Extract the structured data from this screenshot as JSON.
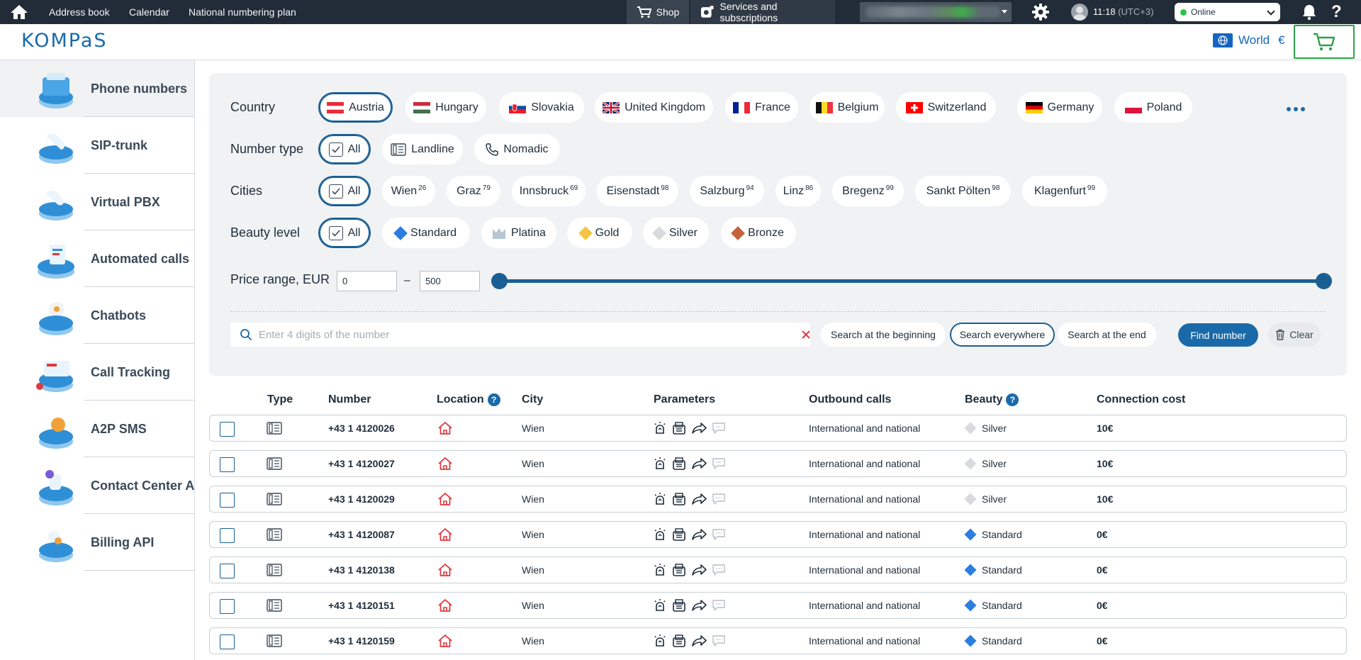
{
  "topbar": {
    "links": [
      "Address book",
      "Calendar",
      "National numbering plan"
    ],
    "shop": "Shop",
    "services": "Services and subscriptions",
    "time": "11:18",
    "timezone": "(UTC+3)",
    "status": "Online",
    "help": "?"
  },
  "header": {
    "logo": "KOMPaS",
    "region": "World",
    "currency": "€"
  },
  "sidebar": {
    "items": [
      {
        "label": "Phone numbers",
        "active": true
      },
      {
        "label": "SIP-trunk",
        "active": false
      },
      {
        "label": "Virtual PBX",
        "active": false
      },
      {
        "label": "Automated calls",
        "active": false
      },
      {
        "label": "Chatbots",
        "active": false
      },
      {
        "label": "Call Tracking",
        "active": false
      },
      {
        "label": "A2P SMS",
        "active": false
      },
      {
        "label": "Contact Center Ai",
        "active": false
      },
      {
        "label": "Billing API",
        "active": false
      }
    ]
  },
  "filters": {
    "country": {
      "label": "Country",
      "options": [
        "Austria",
        "Hungary",
        "Slovakia",
        "United Kingdom",
        "France",
        "Belgium",
        "Switzerland",
        "Germany",
        "Poland"
      ],
      "selected": "Austria"
    },
    "number_type": {
      "label": "Number type",
      "options": [
        "All",
        "Landline",
        "Nomadic"
      ],
      "selected": "All"
    },
    "cities": {
      "label": "Cities",
      "all": "All",
      "options": [
        {
          "name": "Wien",
          "count": "26"
        },
        {
          "name": "Graz",
          "count": "79"
        },
        {
          "name": "Innsbruck",
          "count": "69"
        },
        {
          "name": "Eisenstadt",
          "count": "98"
        },
        {
          "name": "Salzburg",
          "count": "94"
        },
        {
          "name": "Linz",
          "count": "86"
        },
        {
          "name": "Bregenz",
          "count": "99"
        },
        {
          "name": "Sankt Pölten",
          "count": "98"
        },
        {
          "name": "Klagenfurt",
          "count": "99"
        }
      ]
    },
    "beauty": {
      "label": "Beauty level",
      "all": "All",
      "options": [
        {
          "name": "Standard",
          "color": "#2a7de1"
        },
        {
          "name": "Platina",
          "color": "#b8c6d2"
        },
        {
          "name": "Gold",
          "color": "#f4c542"
        },
        {
          "name": "Silver",
          "color": "#d8dadd"
        },
        {
          "name": "Bronze",
          "color": "#c4623a"
        }
      ]
    },
    "price": {
      "label": "Price range, EUR",
      "min": "0",
      "max": "500",
      "dash": "–"
    },
    "search": {
      "placeholder": "Enter 4 digits of the number",
      "modes": [
        "Search at the beginning",
        "Search everywhere",
        "Search at the end"
      ],
      "selected_mode": "Search everywhere",
      "find": "Find number",
      "clear": "Clear"
    }
  },
  "table": {
    "headers": {
      "type": "Type",
      "number": "Number",
      "location": "Location",
      "city": "City",
      "parameters": "Parameters",
      "outbound": "Outbound calls",
      "beauty": "Beauty",
      "cost": "Connection cost"
    },
    "rows": [
      {
        "number": "+43 1 4120026",
        "city": "Wien",
        "outbound": "International and national",
        "beauty": "Silver",
        "beauty_color": "#d8dadd",
        "cost": "10€"
      },
      {
        "number": "+43 1 4120027",
        "city": "Wien",
        "outbound": "International and national",
        "beauty": "Silver",
        "beauty_color": "#d8dadd",
        "cost": "10€"
      },
      {
        "number": "+43 1 4120029",
        "city": "Wien",
        "outbound": "International and national",
        "beauty": "Silver",
        "beauty_color": "#d8dadd",
        "cost": "10€"
      },
      {
        "number": "+43 1 4120087",
        "city": "Wien",
        "outbound": "International and national",
        "beauty": "Standard",
        "beauty_color": "#2a7de1",
        "cost": "0€"
      },
      {
        "number": "+43 1 4120138",
        "city": "Wien",
        "outbound": "International and national",
        "beauty": "Standard",
        "beauty_color": "#2a7de1",
        "cost": "0€"
      },
      {
        "number": "+43 1 4120151",
        "city": "Wien",
        "outbound": "International and national",
        "beauty": "Standard",
        "beauty_color": "#2a7de1",
        "cost": "0€"
      },
      {
        "number": "+43 1 4120159",
        "city": "Wien",
        "outbound": "International and national",
        "beauty": "Standard",
        "beauty_color": "#2a7de1",
        "cost": "0€"
      }
    ]
  },
  "colors": {
    "topbar": "#222c38",
    "accent": "#1a6aa9",
    "cart_border": "#2ea24a",
    "online": "#2ec24a",
    "location_icon": "#e0393e"
  }
}
